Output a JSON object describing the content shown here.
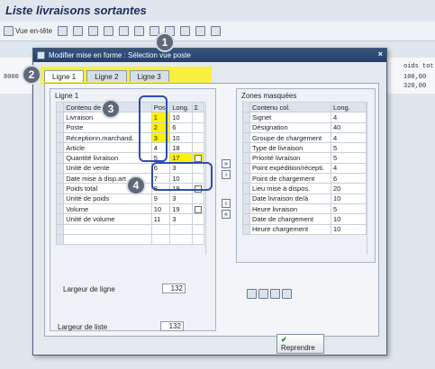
{
  "app": {
    "title": "Liste livraisons sortantes"
  },
  "toolbar": {
    "view_header_label": "Vue en-tête"
  },
  "background": {
    "row1": "8000",
    "col_header": "oids tot",
    "values": [
      "100,00",
      "320,00"
    ]
  },
  "dialog": {
    "title": "Modifier mise en forme : Sélection vue poste",
    "close": "×",
    "tabs": [
      "Ligne 1",
      "Ligne 2",
      "Ligne 3"
    ]
  },
  "left": {
    "group_title": "Ligne 1",
    "headers": [
      "Contenu de c",
      "Pos.",
      "Long."
    ],
    "rows": [
      {
        "name": "Livraison",
        "pos": "1",
        "len": "10",
        "cb": false
      },
      {
        "name": "Poste",
        "pos": "2",
        "len": "6",
        "cb": false
      },
      {
        "name": "Réceptionn.marchand.",
        "pos": "3",
        "len": "10",
        "cb": false
      },
      {
        "name": "Article",
        "pos": "4",
        "len": "18",
        "cb": false
      },
      {
        "name": "Quantité livraison",
        "pos": "5",
        "len": "17",
        "cb": true
      },
      {
        "name": "Unité de vente",
        "pos": "6",
        "len": "3",
        "cb": false
      },
      {
        "name": "Date mise à disp.art",
        "pos": "7",
        "len": "10",
        "cb": false
      },
      {
        "name": "Poids total",
        "pos": "8",
        "len": "19",
        "cb": true
      },
      {
        "name": "Unité de poids",
        "pos": "9",
        "len": "3",
        "cb": false
      },
      {
        "name": "Volume",
        "pos": "10",
        "len": "19",
        "cb": true
      },
      {
        "name": "Unité de volume",
        "pos": "11",
        "len": "3",
        "cb": false
      },
      {
        "name": "",
        "pos": "",
        "len": "",
        "cb": false
      },
      {
        "name": "",
        "pos": "",
        "len": "",
        "cb": false
      }
    ],
    "line_width_label": "Largeur de ligne",
    "line_width": "132",
    "list_width_label": "Largeur de liste",
    "list_width": "132"
  },
  "right": {
    "group_title": "Zones masquées",
    "headers": [
      "Contenu col.",
      "Long."
    ],
    "rows": [
      {
        "name": "Signet",
        "len": "4"
      },
      {
        "name": "Désignation",
        "len": "40"
      },
      {
        "name": "Groupe de chargement",
        "len": "4"
      },
      {
        "name": "Type de livraison",
        "len": "5"
      },
      {
        "name": "Priorité livraison",
        "len": "5"
      },
      {
        "name": "Point expédition/récepti.",
        "len": "4"
      },
      {
        "name": "Point de chargement",
        "len": "6"
      },
      {
        "name": "Lieu mise à dispos.",
        "len": "20"
      },
      {
        "name": "Date livraison de/à",
        "len": "10"
      },
      {
        "name": "Heure livraison",
        "len": "5"
      },
      {
        "name": "Date de chargement",
        "len": "10"
      },
      {
        "name": "Heure chargement",
        "len": "10"
      }
    ]
  },
  "buttons": {
    "reprendre": "Reprendre"
  },
  "callouts": [
    "1",
    "2",
    "3",
    "4"
  ]
}
